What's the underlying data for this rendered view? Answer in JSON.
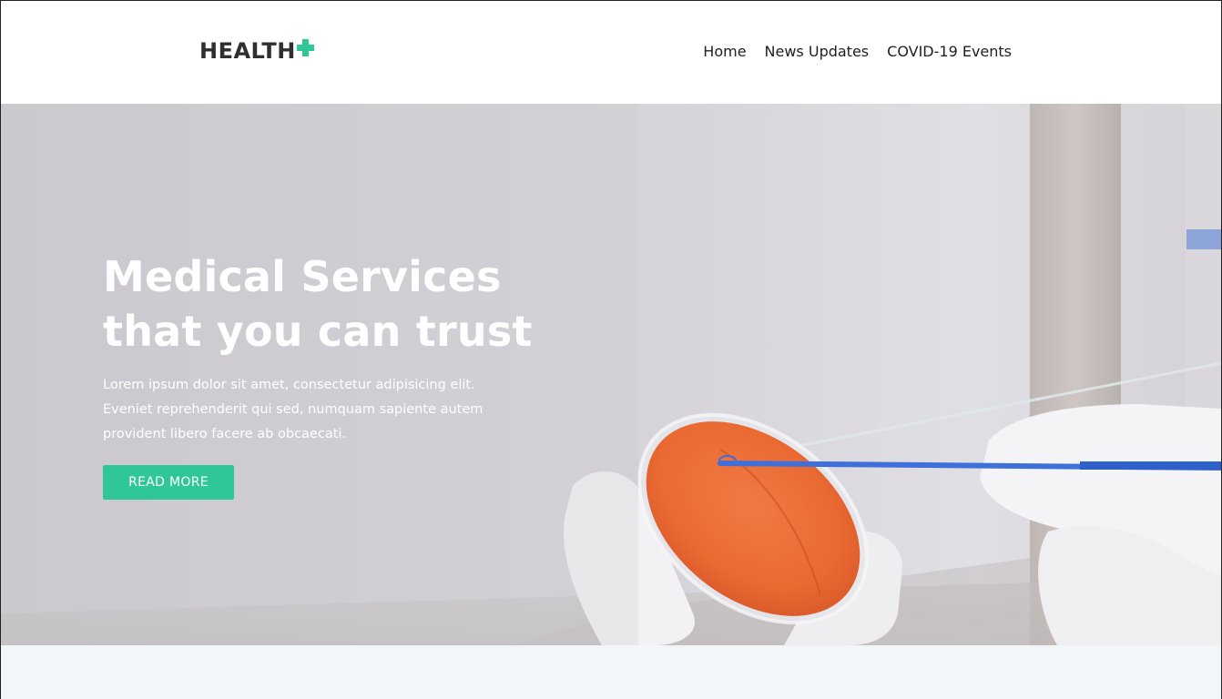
{
  "brand": {
    "name": "HEALTH",
    "logo_icon": "plus-icon",
    "accent_color": "#2fc797"
  },
  "nav": {
    "items": [
      {
        "label": "Home"
      },
      {
        "label": "News Updates"
      },
      {
        "label": "COVID-19 Events"
      }
    ]
  },
  "hero": {
    "title_line1": "Medical Services",
    "title_line2": "that you can trust",
    "body": "Lorem ipsum dolor sit amet, consectetur adipisicing elit. Eveniet reprehenderit qui sed, numquam sapiente autem provident libero facere ab obcaecati.",
    "cta_label": "READ MORE",
    "image_subject": "gloved hands holding a petri dish with orange culture and a blue inoculation loop"
  }
}
